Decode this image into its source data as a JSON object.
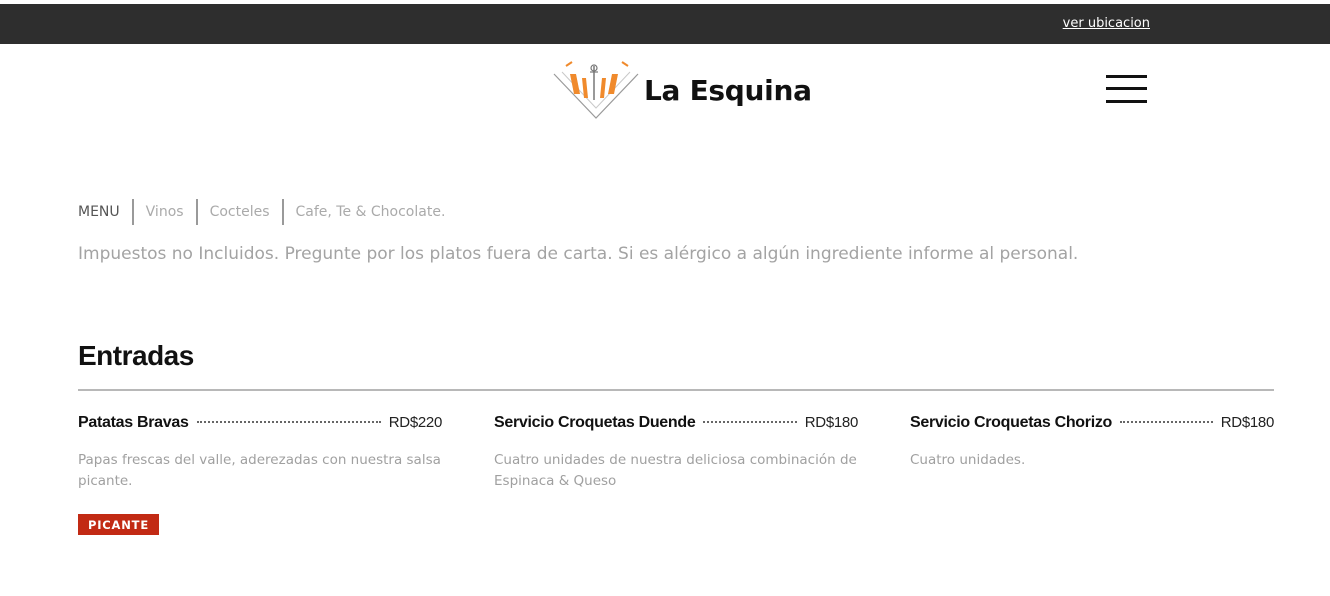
{
  "topbar": {
    "location_link": "ver ubicacion"
  },
  "brand": {
    "name": "La Esquina",
    "accent": "#f08a2c"
  },
  "nav": {
    "tabs": [
      {
        "label": "MENU"
      },
      {
        "label": "Vinos"
      },
      {
        "label": "Cocteles"
      },
      {
        "label": "Cafe, Te & Chocolate."
      }
    ]
  },
  "notice": "Impuestos no Incluidos. Pregunte por los platos fuera de carta. Si es alérgico a algún ingrediente informe al personal.",
  "section": {
    "title": "Entradas",
    "items": [
      {
        "name": "Patatas Bravas",
        "price": "RD$220",
        "description": "Papas frescas del valle, aderezadas con nuestra salsa picante.",
        "badge": "PICANTE"
      },
      {
        "name": "Servicio Croquetas Duende",
        "price": "RD$180",
        "description": "Cuatro unidades de nuestra deliciosa combinación de Espinaca & Queso"
      },
      {
        "name": "Servicio Croquetas Chorizo",
        "price": "RD$180",
        "description": "Cuatro unidades."
      }
    ]
  },
  "colors": {
    "topbar": "#2e2e2e",
    "badge": "#c22a14",
    "muted_text": "#a3a3a3"
  }
}
